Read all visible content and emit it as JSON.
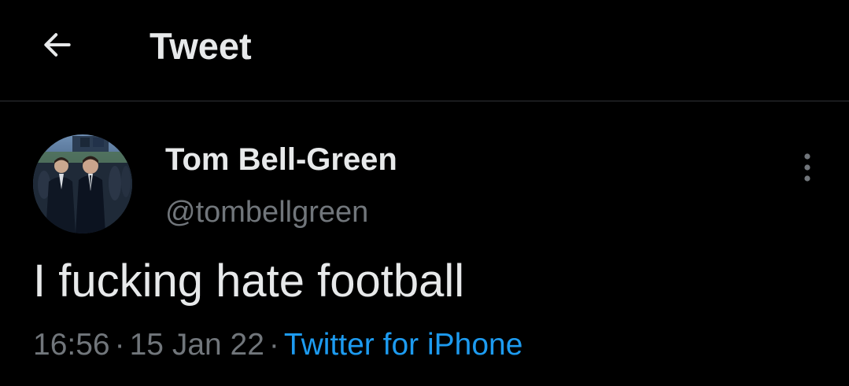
{
  "header": {
    "title": "Tweet",
    "back_icon": "arrow-left-icon"
  },
  "tweet": {
    "author": {
      "display_name": "Tom Bell-Green",
      "handle": "@tombellgreen",
      "avatar": "avatar-photo"
    },
    "more_icon": "more-vertical-icon",
    "text": "I fucking hate football",
    "time": "16:56",
    "date": "15 Jan 22",
    "separator": "·",
    "source": "Twitter for iPhone"
  },
  "colors": {
    "background": "#000000",
    "primary_text": "#e7e9ea",
    "secondary_text": "#71767b",
    "link": "#1d9bf0",
    "divider": "#2f3336"
  }
}
